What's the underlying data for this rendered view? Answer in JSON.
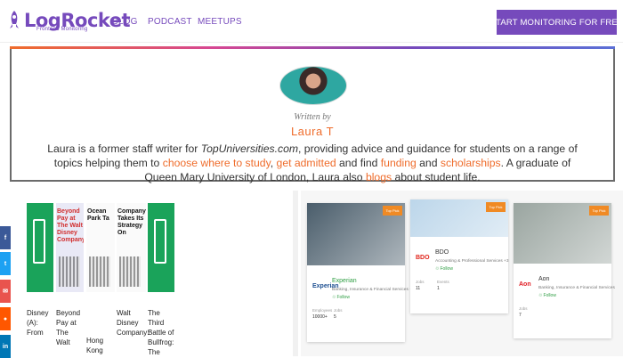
{
  "header": {
    "brand": "LogRocket",
    "brand_sub": "Frontend Monitoring",
    "nav": [
      "BLOG",
      "PODCAST",
      "MEETUPS"
    ],
    "cta": "START MONITORING FOR FREE"
  },
  "author": {
    "written_by": "Written by",
    "name": "Laura T",
    "bio": [
      {
        "t": "Laura is a former staff writer for "
      },
      {
        "t": "TopUniversities.com",
        "italic": true
      },
      {
        "t": ", providing advice and guidance for students on a range of topics helping them to "
      },
      {
        "t": "choose where to study",
        "hl": true
      },
      {
        "t": ", "
      },
      {
        "t": "get admitted",
        "hl": true
      },
      {
        "t": " and find "
      },
      {
        "t": "funding",
        "hl": true
      },
      {
        "t": " and "
      },
      {
        "t": "scholarships",
        "hl": true
      },
      {
        "t": ". A graduate of Queen Mary University of London, Laura also "
      },
      {
        "t": "blogs",
        "hl": true
      },
      {
        "t": " about student life."
      }
    ]
  },
  "social": [
    {
      "icon": "facebook-icon",
      "glyph": "f",
      "color": "#3b5998"
    },
    {
      "icon": "twitter-icon",
      "glyph": "t",
      "color": "#1da1f2"
    },
    {
      "icon": "email-icon",
      "glyph": "✉",
      "color": "#e9544e"
    },
    {
      "icon": "reddit-icon",
      "glyph": "●",
      "color": "#ff5700"
    },
    {
      "icon": "linkedin-icon",
      "glyph": "in",
      "color": "#0077b5"
    }
  ],
  "books": [
    {
      "label": "Disney (A): From",
      "color": "#1aa35a",
      "cover": "green"
    },
    {
      "label": "Beyond Pay at The Walt",
      "color": "#e9e9f6",
      "cover": "Beyond Pay at The Walt Disney Company",
      "accent": "#d12d2d"
    },
    {
      "label": "Hong Kong",
      "color": "#fafafa",
      "cover": "Ocean Park Ta",
      "accent": "#111"
    },
    {
      "label": "Walt Disney Company:",
      "color": "#fafafa",
      "cover": "Company Takes Its Strategy On",
      "accent": "#111"
    },
    {
      "label": "The Third Battle of Bullfrog: The",
      "color": "#1aa35a",
      "cover": "green"
    }
  ],
  "companies": [
    {
      "name": "Experian",
      "logo": "Experian",
      "logo_color": "#1d4f91",
      "desc": "Banking, Insurance & Financial Services +8",
      "follow": "Follow",
      "badge": "Top Pick",
      "stats": [
        {
          "label": "Employees",
          "value": "10000+"
        },
        {
          "label": "Jobs",
          "value": "5"
        }
      ],
      "img": "#4a5d6b"
    },
    {
      "name": "BDO",
      "logo": "BDO",
      "logo_color": "#e1251b",
      "desc": "Accounting & Professional Services +3",
      "follow": "Follow",
      "badge": "Top Pick",
      "stats": [
        {
          "label": "Jobs",
          "value": "11"
        },
        {
          "label": "Events",
          "value": "1"
        }
      ],
      "img": "#bcd6ea"
    },
    {
      "name": "Aon",
      "logo": "Aon",
      "logo_color": "#e11b22",
      "desc": "Banking, Insurance & Financial Services",
      "follow": "Follow",
      "badge": "Top Pick",
      "stats": [
        {
          "label": "Jobs",
          "value": "7"
        }
      ],
      "img": "#9aa5a0"
    }
  ]
}
